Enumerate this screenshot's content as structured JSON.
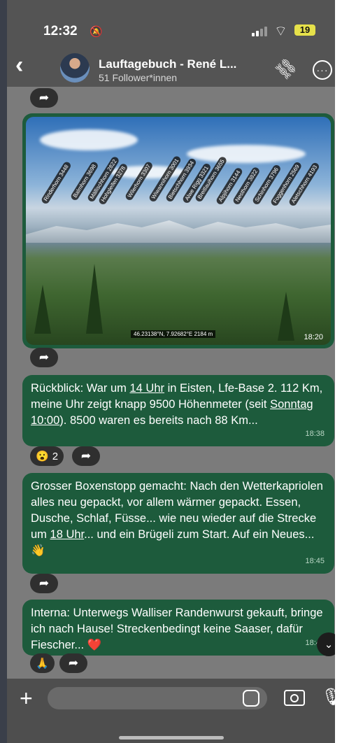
{
  "status": {
    "time": "12:32",
    "battery": "19"
  },
  "header": {
    "title": "Lauftagebuch - René L...",
    "subtitle": "51 Follower*innen"
  },
  "photo": {
    "peaks": [
      "Rinderhorn 3448",
      "Balmhorn 3698",
      "Hohgleifen 3278",
      "Mällischhorn 2822",
      "Wilerhorn 3307",
      "Wiwannihorn 3001",
      "Bietschhorn 3934",
      "Breitlauihorn 3655",
      "Alwe Rigg 3321",
      "Alpjihorn 3144",
      "Nesthorn 3822",
      "Schinhorn 3796",
      "Foggenhorn 2569",
      "Aletschhorn 4193"
    ],
    "coords": "46.23138°N, 7.92682°E 2184 m",
    "time": "18:20"
  },
  "messages": [
    {
      "p1": "Rückblick: War um ",
      "u1": "14 Uhr",
      "p2": " in Eisten, Lfe-Base 2. 112 Km, meine Uhr zeigt knapp 9500 Höhenmeter (seit ",
      "u2": "Sonntag 10:00",
      "p3": "). 8500 waren es bereits nach 88 Km...",
      "time": "18:38",
      "reaction_emoji": "😮",
      "reaction_count": "2"
    },
    {
      "p1": "Grosser Boxenstopp gemacht: Nach den Wetterkapriolen alles neu gepackt, vor allem wärmer gepackt. Essen, Dusche, Schlaf, Füsse... wie neu wieder auf die Strecke um ",
      "u1": "18 Uhr",
      "p2": "... und ein Brügeli zum Start. Auf ein Neues... 👋",
      "time": "18:45"
    },
    {
      "p1": "Interna: Unterwegs Walliser Randenwurst gekauft, bringe ich nach Hause! Streckenbedingt keine Saaser, dafür Fiescher... ❤️",
      "time": "18:48",
      "reaction_emoji": "🙏"
    }
  ],
  "input": {
    "placeholder": ""
  }
}
